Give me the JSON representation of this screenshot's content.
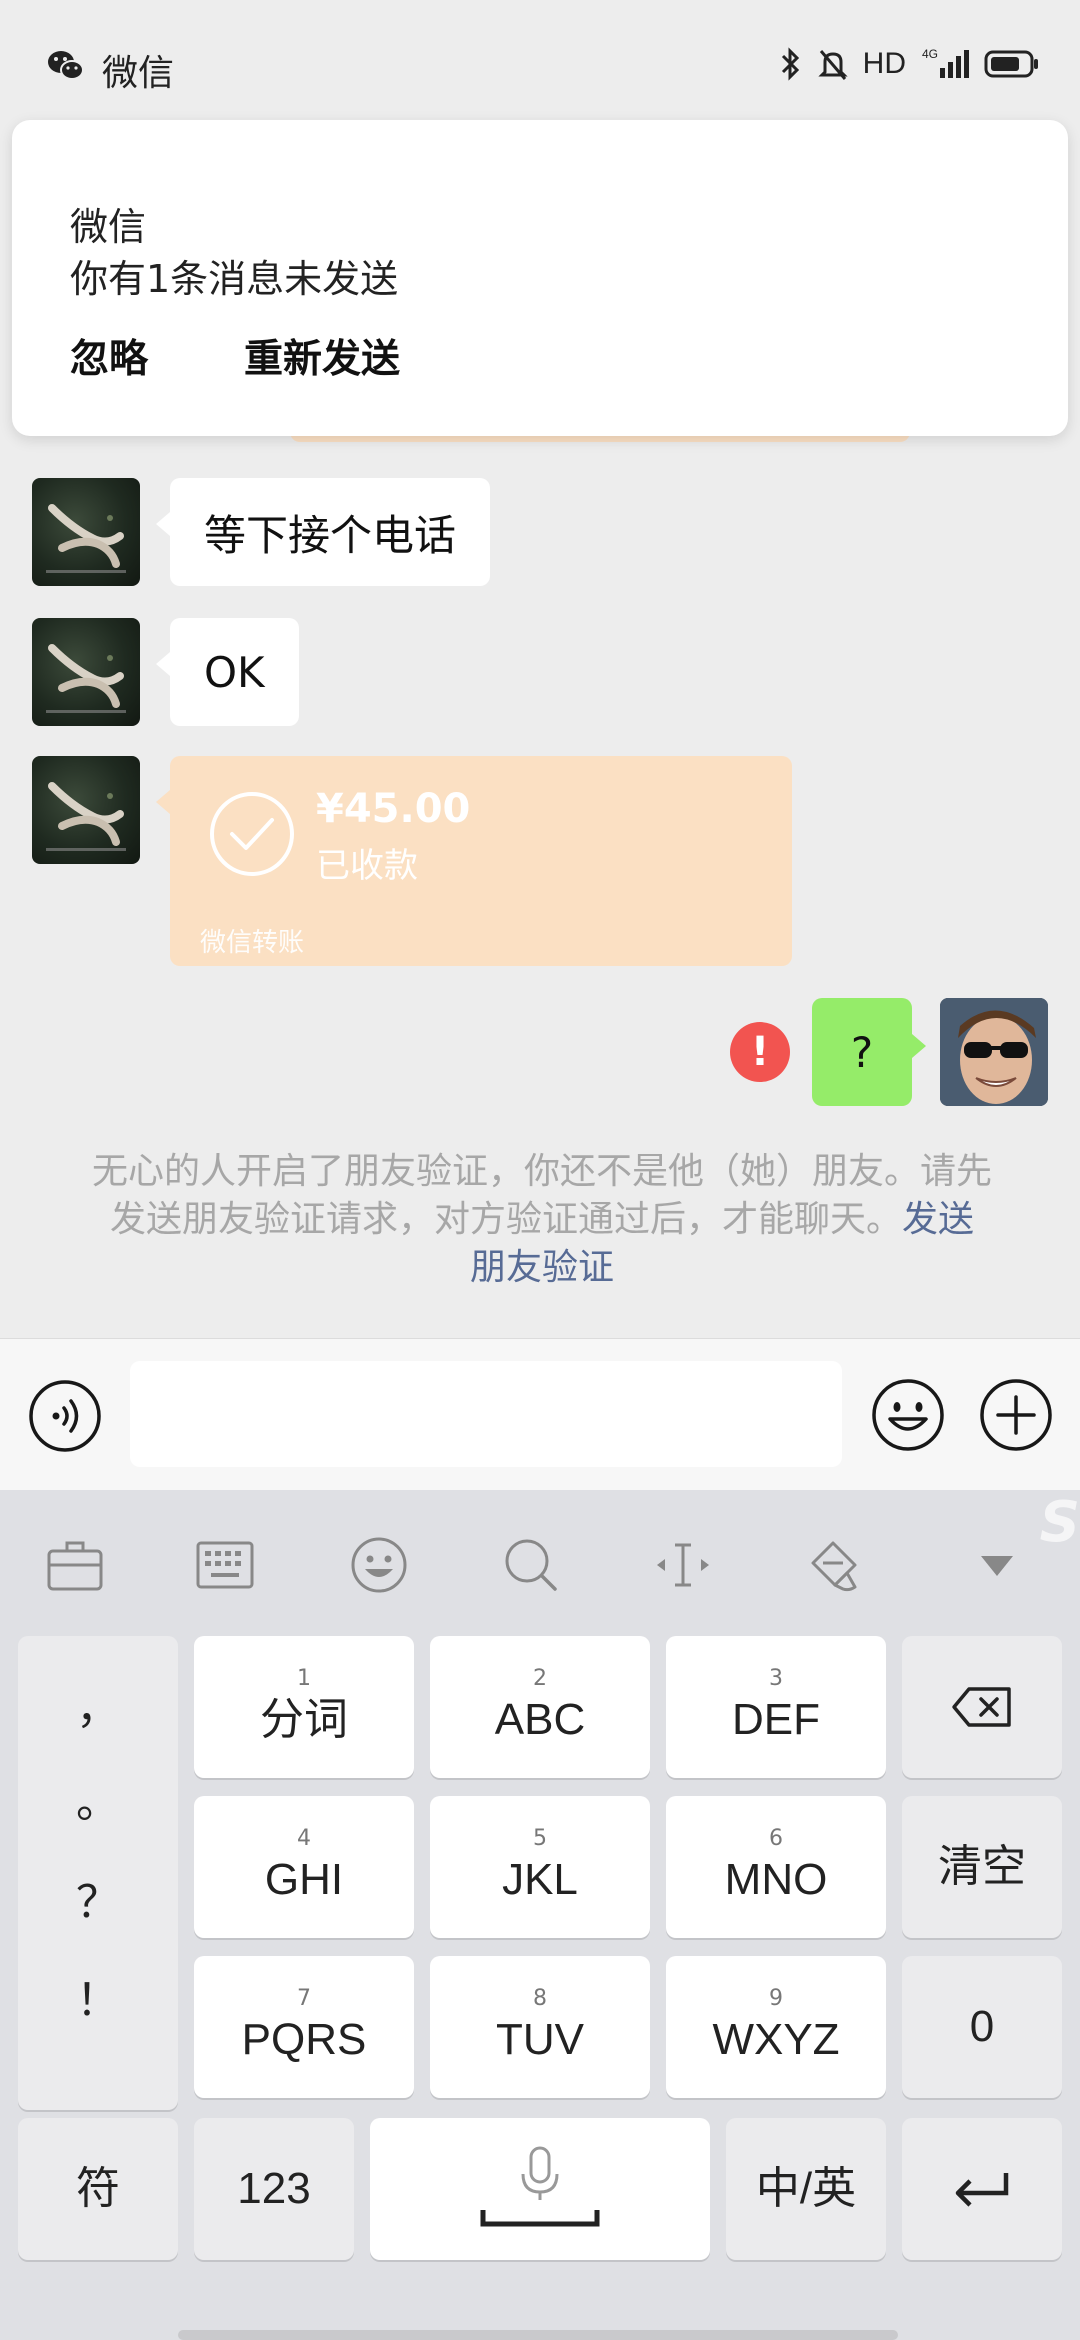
{
  "status_bar": {
    "app_name": "微信",
    "hd_label": "HD",
    "network_label": "4G"
  },
  "notification": {
    "app": "微信",
    "message": "你有1条消息未发送",
    "ignore_label": "忽略",
    "resend_label": "重新发送"
  },
  "messages": [
    {
      "from": "other",
      "text": "等下接个电话"
    },
    {
      "from": "other",
      "text": "OK"
    }
  ],
  "transfer": {
    "amount": "¥45.00",
    "status": "已收款",
    "footer": "微信转账"
  },
  "my_message": {
    "text": "?",
    "error_mark": "!"
  },
  "system_note": {
    "text": "无心的人开启了朋友验证，你还不是他（她）朋友。请先发送朋友验证请求，对方验证通过后，才能聊天。",
    "link": "发送朋友验证"
  },
  "input": {
    "value": "",
    "placeholder": ""
  },
  "keyboard": {
    "keys": [
      {
        "num": "1",
        "label": "分词"
      },
      {
        "num": "2",
        "label": "ABC"
      },
      {
        "num": "3",
        "label": "DEF"
      },
      {
        "num": "4",
        "label": "GHI"
      },
      {
        "num": "5",
        "label": "JKL"
      },
      {
        "num": "6",
        "label": "MNO"
      },
      {
        "num": "7",
        "label": "PQRS"
      },
      {
        "num": "8",
        "label": "TUV"
      },
      {
        "num": "9",
        "label": "WXYZ"
      }
    ],
    "punctuation": [
      "，",
      "。",
      "？",
      "！"
    ],
    "clear_label": "清空",
    "zero_label": "0",
    "symbol_label": "符",
    "numeric_label": "123",
    "lang_label": "中/英",
    "logo": "S"
  },
  "colors": {
    "accent_green": "#95ec69",
    "transfer_orange": "#fbe0c3",
    "error_red": "#f25450",
    "link_blue": "#576b95"
  }
}
